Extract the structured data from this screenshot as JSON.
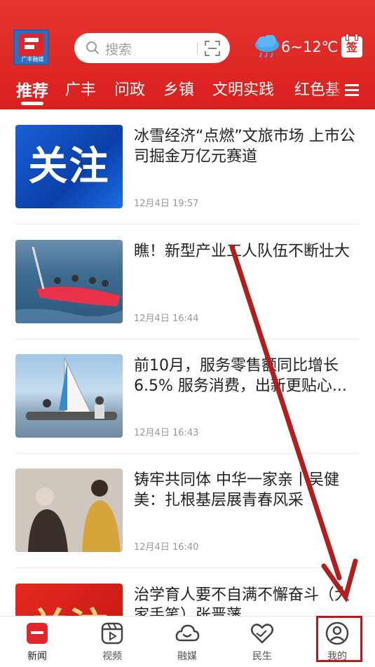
{
  "header": {
    "logo_text": "广丰融媒",
    "search_placeholder": "搜索",
    "temperature": "6~12℃",
    "calendar_label": "签"
  },
  "tabs": [
    "推荐",
    "广丰",
    "问政",
    "乡镇",
    "文明实践",
    "红色基"
  ],
  "active_tab": "推荐",
  "feed": [
    {
      "title": "冰雪经济“点燃”文旅市场 上市公司掘金万亿元赛道",
      "time": "12月4日 19:57",
      "thumb_text": "关注"
    },
    {
      "title": "瞧！新型产业工人队伍不断壮大",
      "time": "12月4日 16:44"
    },
    {
      "title": "前10月，服务零售额同比增长6.5% 服务消费，出新更贴心...",
      "time": "12月4日 16:43"
    },
    {
      "title": "铸牢共同体 中华一家亲丨吴健美：扎根基层展青春风采",
      "time": "12月4日 16:40"
    },
    {
      "title": "治学育人要不自满不懈奋斗（大家手笔）张晋藩",
      "time": "",
      "thumb_text": "关注"
    }
  ],
  "bottom_nav": [
    {
      "label": "新闻",
      "icon": "news-icon"
    },
    {
      "label": "视频",
      "icon": "video-icon"
    },
    {
      "label": "融媒",
      "icon": "cloud-icon"
    },
    {
      "label": "民生",
      "icon": "heart-hands-icon"
    },
    {
      "label": "我的",
      "icon": "user-icon"
    }
  ],
  "colors": {
    "brand": "#d8201f",
    "annotation": "#b01e1e"
  }
}
